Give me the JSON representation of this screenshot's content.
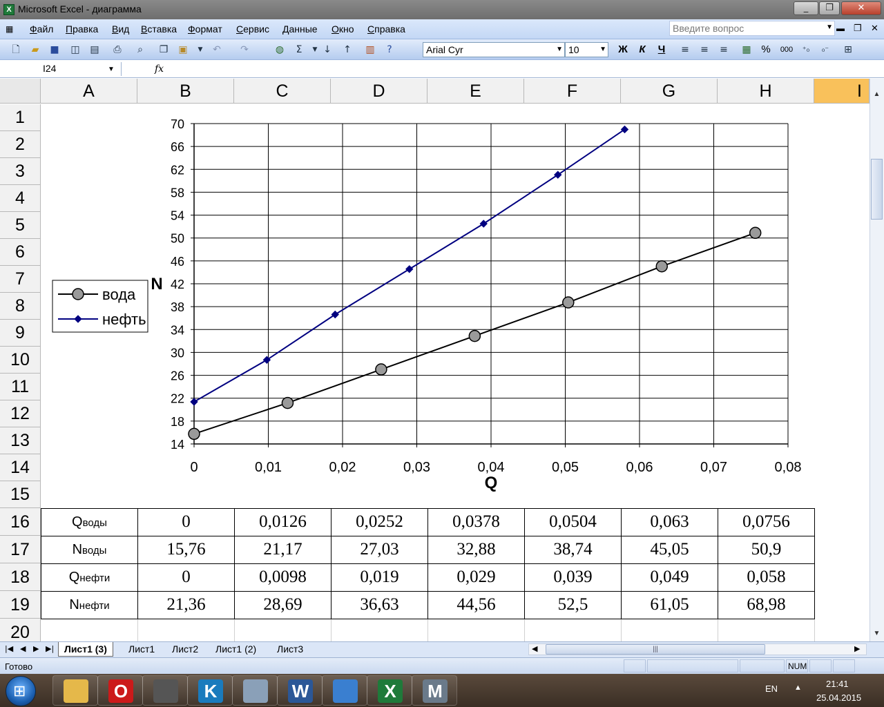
{
  "window": {
    "title": "Microsoft Excel - диаграмма",
    "icon_name": "excel-app-icon"
  },
  "menu": [
    "Файл",
    "Правка",
    "Вид",
    "Вставка",
    "Формат",
    "Сервис",
    "Данные",
    "Окно",
    "Справка"
  ],
  "ask_placeholder": "Введите вопрос",
  "toolbar": {
    "font": "Arial Cyr",
    "size": "10",
    "bold": "Ж",
    "italic": "К",
    "underline": "Ч",
    "percent": "%",
    "thousands": "000"
  },
  "namebox": "I24",
  "fx_label": "fx",
  "columns": [
    "A",
    "B",
    "C",
    "D",
    "E",
    "F",
    "G",
    "H",
    "I"
  ],
  "selected_column": "I",
  "rows": [
    "1",
    "2",
    "3",
    "4",
    "5",
    "6",
    "7",
    "8",
    "9",
    "10",
    "11",
    "12",
    "13",
    "14",
    "15",
    "16",
    "17",
    "18",
    "19",
    "20"
  ],
  "table": {
    "labels": [
      {
        "main": "Q",
        "sub": "воды"
      },
      {
        "main": "N",
        "sub": "воды"
      },
      {
        "main": "Q",
        "sub": "нефти"
      },
      {
        "main": "N",
        "sub": "нефти"
      }
    ],
    "values": [
      [
        "0",
        "0,0126",
        "0,0252",
        "0,0378",
        "0,0504",
        "0,063",
        "0,0756"
      ],
      [
        "15,76",
        "21,17",
        "27,03",
        "32,88",
        "38,74",
        "45,05",
        "50,9"
      ],
      [
        "0",
        "0,0098",
        "0,019",
        "0,029",
        "0,039",
        "0,049",
        "0,058"
      ],
      [
        "21,36",
        "28,69",
        "36,63",
        "44,56",
        "52,5",
        "61,05",
        "68,98"
      ]
    ]
  },
  "chart_data": {
    "type": "line",
    "xlabel": "Q",
    "ylabel": "N",
    "xlim": [
      0,
      0.08
    ],
    "ylim": [
      14,
      70
    ],
    "x_ticks": [
      "0",
      "0,01",
      "0,02",
      "0,03",
      "0,04",
      "0,05",
      "0,06",
      "0,07",
      "0,08"
    ],
    "y_ticks": [
      "14",
      "18",
      "22",
      "26",
      "30",
      "34",
      "38",
      "42",
      "46",
      "50",
      "54",
      "58",
      "62",
      "66",
      "70"
    ],
    "grid": true,
    "legend_position": "left",
    "series": [
      {
        "name": "вода",
        "color": "#000000",
        "marker": "circle",
        "marker_fill": "#9a9a9a",
        "x": [
          0,
          0.0126,
          0.0252,
          0.0378,
          0.0504,
          0.063,
          0.0756
        ],
        "y": [
          15.76,
          21.17,
          27.03,
          32.88,
          38.74,
          45.05,
          50.9
        ]
      },
      {
        "name": "нефть",
        "color": "#000080",
        "marker": "diamond",
        "marker_fill": "#000080",
        "x": [
          0,
          0.0098,
          0.019,
          0.029,
          0.039,
          0.049,
          0.058
        ],
        "y": [
          21.36,
          28.69,
          36.63,
          44.56,
          52.5,
          61.05,
          68.98
        ]
      }
    ]
  },
  "sheet_tabs": [
    "Лист1 (3)",
    "Лист1",
    "Лист2",
    "Лист1 (2)",
    "Лист3"
  ],
  "active_sheet": "Лист1 (3)",
  "status": {
    "text": "Готово",
    "num": "NUM"
  },
  "taskbar": {
    "apps": [
      {
        "name": "explorer-icon",
        "letter": "",
        "color": "#e5b84a"
      },
      {
        "name": "opera-icon",
        "letter": "O",
        "color": "#cc1a1a"
      },
      {
        "name": "network-computer-icon",
        "letter": "",
        "color": "#555555"
      },
      {
        "name": "kaspersky-icon",
        "letter": "K",
        "color": "#1a7bbd"
      },
      {
        "name": "calculator-icon",
        "letter": "",
        "color": "#8aa0b8"
      },
      {
        "name": "word-icon",
        "letter": "W",
        "color": "#2b5797"
      },
      {
        "name": "paint-icon",
        "letter": "",
        "color": "#3a7fd0"
      },
      {
        "name": "excel-icon",
        "letter": "X",
        "color": "#1f7a3a"
      },
      {
        "name": "mathcad-icon",
        "letter": "M",
        "color": "#6a7a8a"
      }
    ],
    "lang": "EN",
    "time": "21:41",
    "date": "25.04.2015"
  }
}
